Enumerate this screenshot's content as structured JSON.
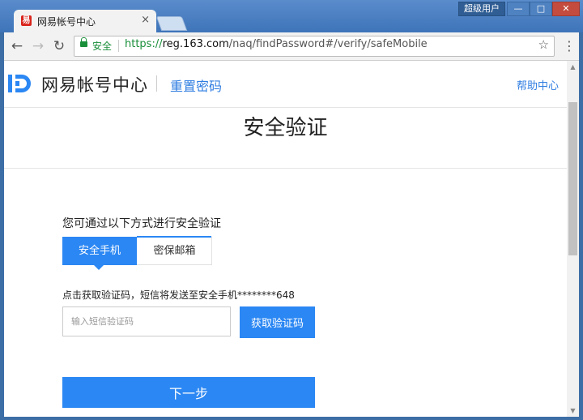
{
  "browser": {
    "tab_title": "网易帐号中心",
    "tab_favicon_glyph": "易",
    "tab_close": "×",
    "user_button": "超级用户",
    "window_buttons": {
      "minimize": "—",
      "maximize": "□",
      "close": "✕"
    },
    "nav": {
      "back": "←",
      "forward": "→",
      "reload": "↻"
    },
    "secure_label": "安全",
    "url_scheme": "https://",
    "url_host": "reg.163.com",
    "url_path": "/naq/findPassword#/verify/safeMobile",
    "star": "☆",
    "menu": "⋮"
  },
  "header": {
    "logo_text": "网易帐号中心",
    "section_title": "重置密码",
    "help_link": "帮助中心",
    "accent_color": "#2b87f3"
  },
  "main": {
    "page_title": "安全验证",
    "verify_prompt": "您可通过以下方式进行安全验证",
    "tabs": [
      {
        "label": "安全手机",
        "active": true
      },
      {
        "label": "密保邮箱",
        "active": false
      }
    ],
    "sms_notice": "点击获取验证码，短信将发送至安全手机********648",
    "code_input_placeholder": "输入短信验证码",
    "code_input_value": "",
    "get_code_button": "获取验证码",
    "next_button": "下一步"
  }
}
